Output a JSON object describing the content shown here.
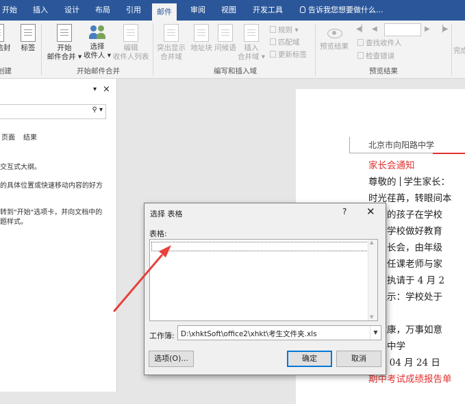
{
  "tabs": [
    "开始",
    "插入",
    "设计",
    "布局",
    "引用",
    "邮件",
    "审阅",
    "视图",
    "开发工具"
  ],
  "tell_me": "告诉我您想要做什么...",
  "ribbon": {
    "envelope_label": "信封",
    "labels_label": "标签",
    "group_create": "创建",
    "start_merge_line1": "开始",
    "start_merge_line2": "邮件合并 ▾",
    "select_recipients_line1": "选择",
    "select_recipients_line2": "收件人 ▾",
    "edit_recipients_line1": "编辑",
    "edit_recipients_line2": "收件人列表",
    "group_start_merge": "开始邮件合并",
    "highlight_fields_line1": "突出显示",
    "highlight_fields_line2": "合并域",
    "address_block": "地址块",
    "greeting_line": "问候语",
    "insert_merge_field_line1": "插入",
    "insert_merge_field_line2": "合并域 ▾",
    "rules": "规则 ▾",
    "match_fields": "匹配域",
    "update_labels": "更新标签",
    "group_write_insert": "编写和插入域",
    "preview_results": "预览结果",
    "find_recipient": "查找收件人",
    "check_errors": "检查错误",
    "group_preview": "预览结果",
    "finish_partial": "完成"
  },
  "nav_pane": {
    "tab_headings": "页面",
    "tab_results": "结果",
    "text1": "交互式大纲。",
    "text2": "的具体位置或快速移动内容的好方",
    "text3": "转到\"开始\"选项卡，并向文档中的",
    "text4": "题样式。"
  },
  "document": {
    "header": "北京市向阳路中学",
    "lines": [
      "家长会通知",
      "尊敬的",
      "学生家长：",
      "时光荏苒，转眼间本",
      "了您的孩子在学校",
      "配合学校做好教育",
      "级家长会，由年级",
      "任和任课老师与家",
      "会回执请于 4 月 2",
      "馨提示：学校处于",
      "况",
      "体健康，万事如意",
      "阳路中学",
      "4 年 04 月 24 日",
      "期中考试成绩报告单"
    ]
  },
  "dialog": {
    "title": "选择 表格",
    "help": "?",
    "close": "✕",
    "table_label": "表格:",
    "workbook_label": "工作簿:",
    "workbook_value": "D:\\xhktSoft\\office2\\xhkt\\考生文件夹.xls",
    "options_button": "选项(O)...",
    "ok_button": "确定",
    "cancel_button": "取消"
  },
  "colors": {
    "tabbar": "#2b579a",
    "ribbon_bg": "#f3f3f3",
    "red_text": "#e03030",
    "arrow": "#e8403a",
    "dialog_bg": "#f0f0f0",
    "ok_border": "#0078d7"
  }
}
